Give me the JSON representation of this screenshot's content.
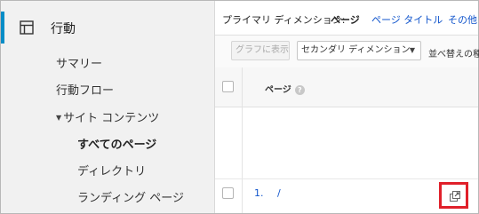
{
  "sidebar": {
    "section_icon": "layout-panel-icon",
    "section_title": "行動",
    "items": [
      {
        "label": "サマリー"
      },
      {
        "label": "行動フロー"
      },
      {
        "label": "サイト コンテンツ",
        "expanded": true
      },
      {
        "label": "すべてのページ",
        "active": true
      },
      {
        "label": "ディレクトリ"
      },
      {
        "label": "ランディング ページ"
      }
    ]
  },
  "dimension_bar": {
    "label": "プライマリ ディメンション:",
    "active": "ページ",
    "link1": "ページ タイトル",
    "link2": "その他"
  },
  "toolbar": {
    "graph_button": "グラフに表示",
    "secondary_dimension": "セカンダリ ディメンション",
    "sort_label": "並べ替えの種"
  },
  "table": {
    "header_page": "ページ",
    "header_help_icon": "help-icon",
    "rows": [
      {
        "index": "1.",
        "page": "/",
        "action_icon": "open-external-icon"
      }
    ]
  },
  "colors": {
    "accent": "#058dc7",
    "link": "#1155cc",
    "highlight": "#e0202a"
  }
}
